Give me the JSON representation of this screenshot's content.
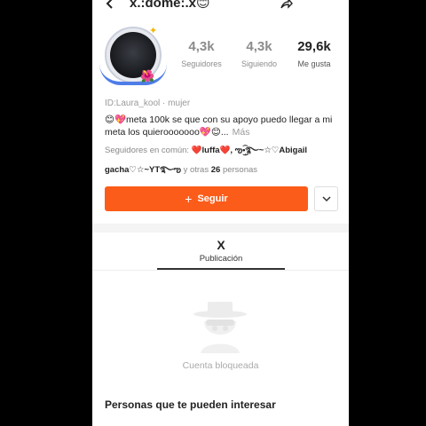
{
  "header": {
    "title": "x.:dome:.x😊"
  },
  "profile": {
    "stats": [
      {
        "value": "4,3k",
        "label": "Seguidores"
      },
      {
        "value": "4,3k",
        "label": "Siguiendo"
      },
      {
        "value": "29,6k",
        "label": "Me gusta"
      }
    ],
    "id_text": "ID:Laura_kool",
    "separator": "·",
    "gender": "mujer",
    "bio": "😊💖meta 100k se que con su apoyo puedo llegar a mi meta los quierooooooo💖😊...",
    "bio_more": "Más",
    "common_label": "Seguidores en común:",
    "common_names": "❤️luffa❤️, ఌ•ۣ͜͡࿐~☆♡Abigail",
    "friends_name": "gacha♡☆~YT࿐ఌ",
    "friends_and": "y otras",
    "friends_count": "26",
    "friends_suffix": "personas"
  },
  "actions": {
    "follow_plus": "+",
    "follow_label": "Seguir"
  },
  "tabs": [
    {
      "value": "X",
      "label": "Publicación"
    }
  ],
  "content": {
    "blocked_text": "Cuenta bloqueada"
  },
  "suggestions": {
    "title": "Personas que te pueden interesar"
  },
  "colors": {
    "accent": "#fc5c1a",
    "avatar_ring": "#4f7de8"
  },
  "icons": [
    "back-arrow-icon",
    "share-icon",
    "chevron-down-icon",
    "blocked-user-icon"
  ]
}
